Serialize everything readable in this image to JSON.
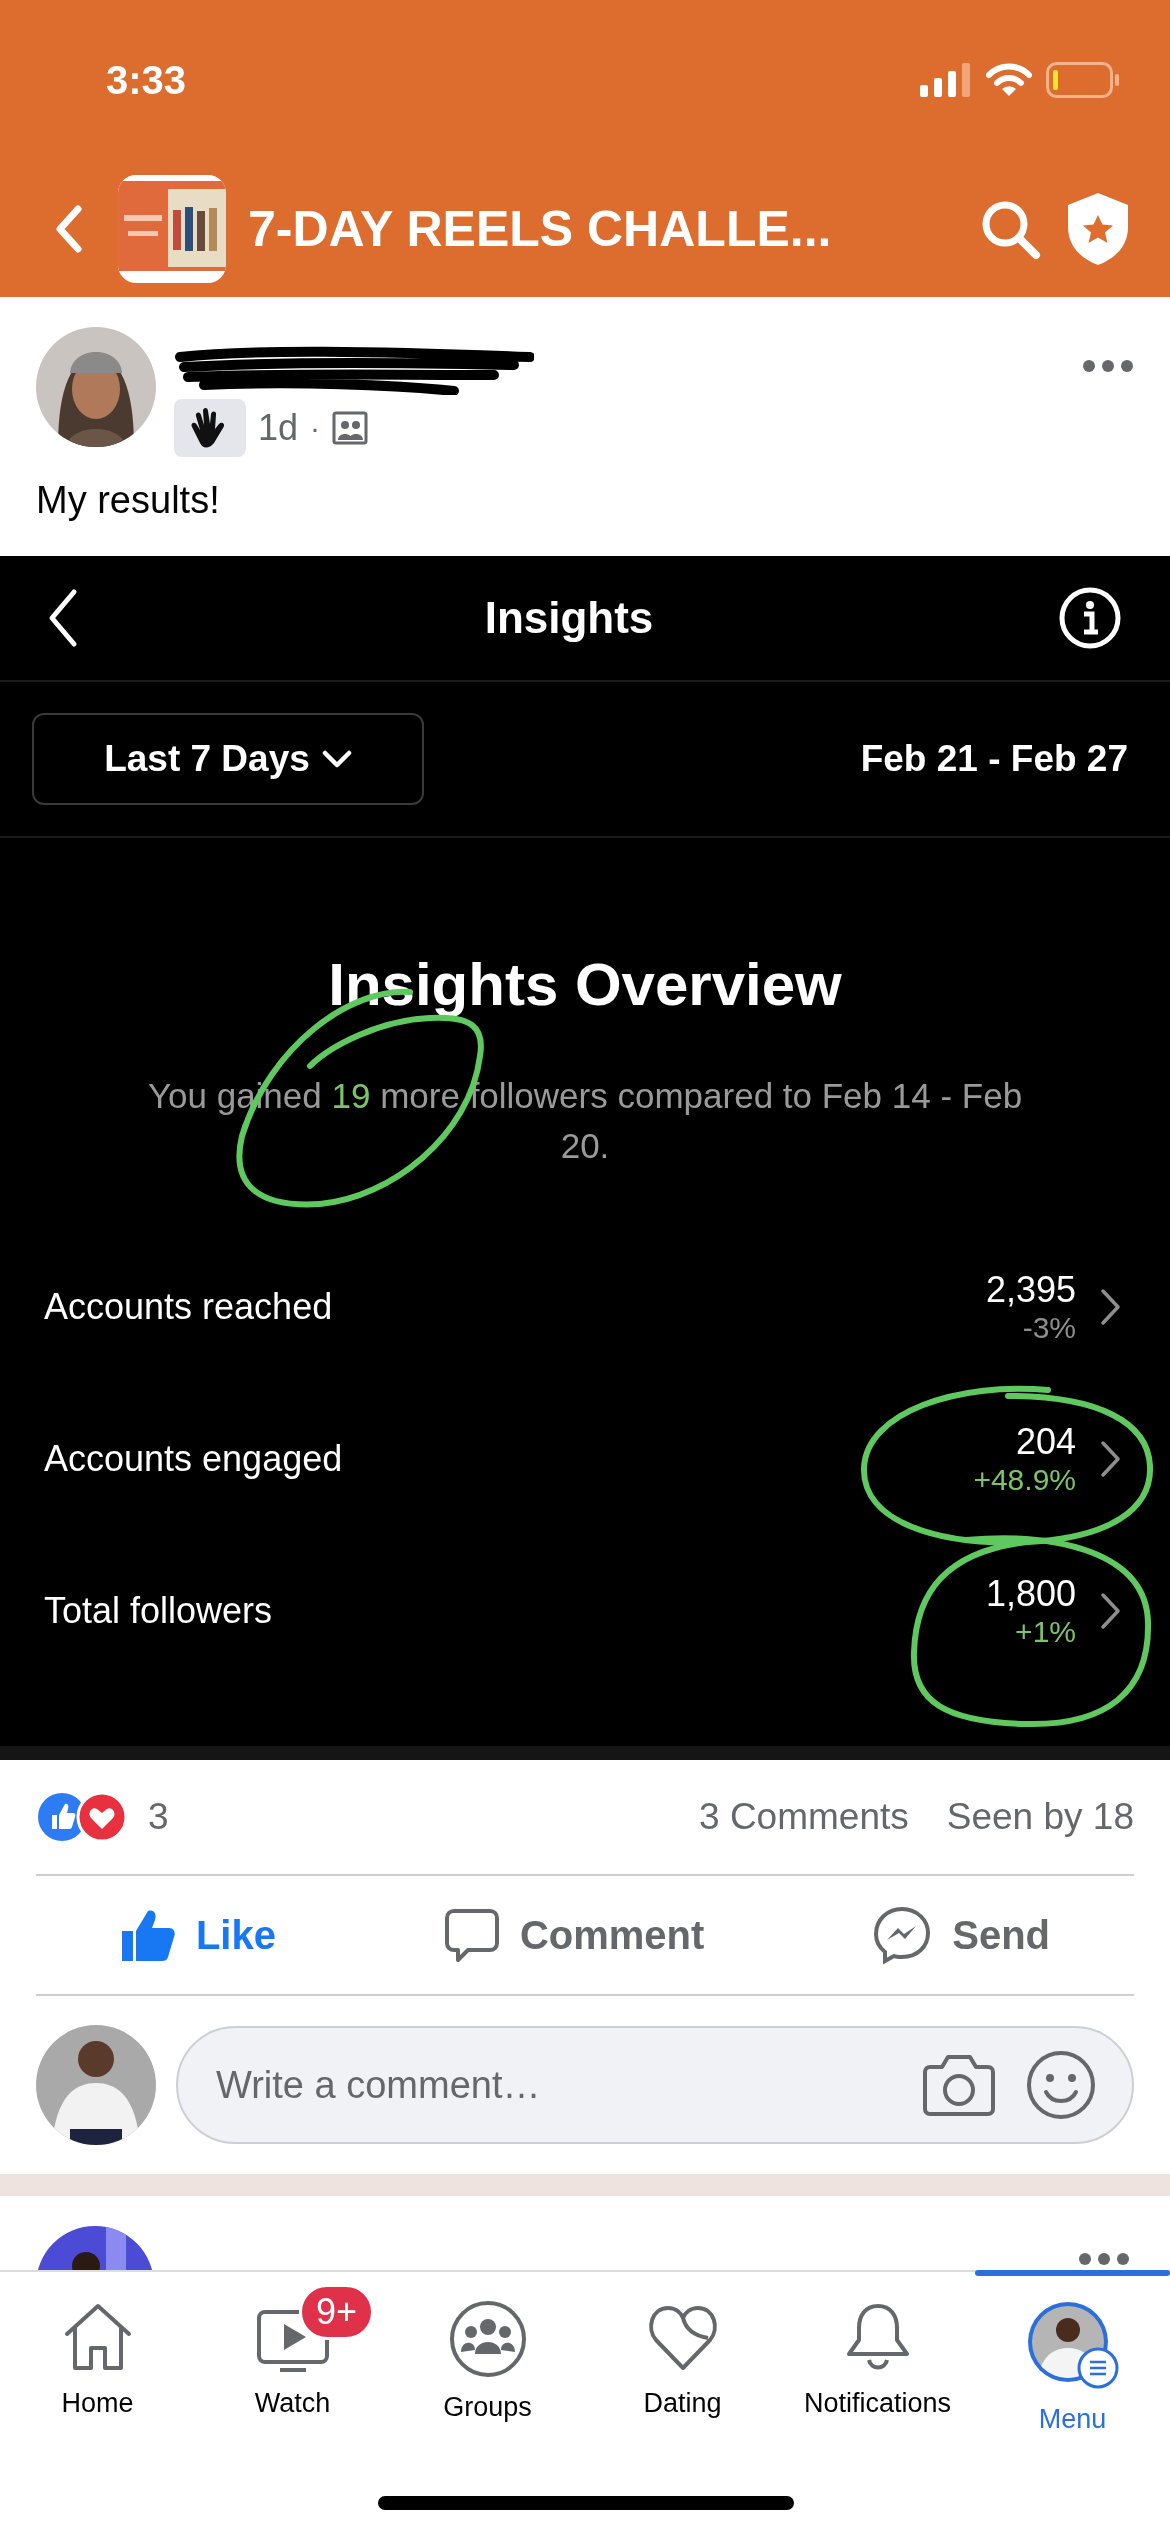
{
  "status_bar": {
    "time": "3:33"
  },
  "header": {
    "title": "7-DAY REELS CHALLE..."
  },
  "post": {
    "time": "1d",
    "separator": "·",
    "text": "My results!"
  },
  "insights": {
    "title": "Insights",
    "range": "Last 7 Days",
    "dates": "Feb 21 - Feb 27",
    "overview_title": "Insights Overview",
    "summary": {
      "before": "You gained ",
      "highlight": "19",
      "after": " more followers compared to Feb 14 - Feb 20."
    },
    "metrics": [
      {
        "label": "Accounts reached",
        "value": "2,395",
        "change": "-3%",
        "color": "#8e8e8e"
      },
      {
        "label": "Accounts engaged",
        "value": "204",
        "change": "+48.9%",
        "color": "#7cc46a"
      },
      {
        "label": "Total followers",
        "value": "1,800",
        "change": "+1%",
        "color": "#7cc46a"
      }
    ]
  },
  "reactions": {
    "count": "3",
    "comments": "3 Comments",
    "seen": "Seen by 18"
  },
  "actions": [
    {
      "label": "Like",
      "kind": "like",
      "selected": true
    },
    {
      "label": "Comment",
      "kind": "comment",
      "selected": false
    },
    {
      "label": "Send",
      "kind": "send",
      "selected": false
    }
  ],
  "comment_box": {
    "placeholder": "Write a comment…"
  },
  "tabs": [
    {
      "label": "Home",
      "kind": "home",
      "selected": false
    },
    {
      "label": "Watch",
      "kind": "watch",
      "badge": "9+",
      "selected": false
    },
    {
      "label": "Groups",
      "kind": "groups",
      "selected": false
    },
    {
      "label": "Dating",
      "kind": "dating",
      "selected": false
    },
    {
      "label": "Notifications",
      "kind": "notifications",
      "selected": false
    },
    {
      "label": "Menu",
      "kind": "menu",
      "selected": true
    }
  ]
}
